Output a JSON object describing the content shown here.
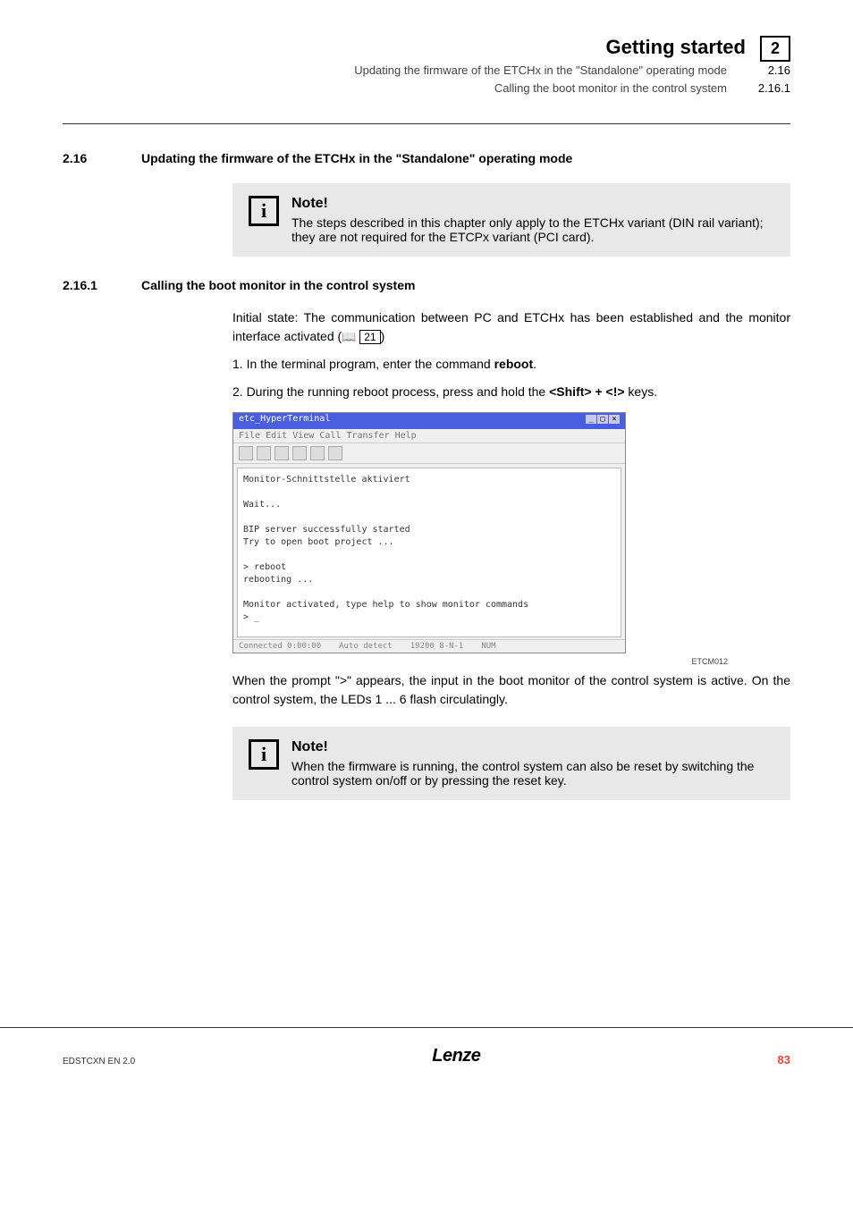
{
  "header": {
    "title": "Getting started",
    "sub1": "Updating the firmware of the ETCHx in the \"Standalone\" operating mode",
    "sub2": "Calling the boot monitor in the control system",
    "chapter": "2",
    "sec1": "2.16",
    "sec2": "2.16.1"
  },
  "s1": {
    "num": "2.16",
    "title": "Updating the firmware of the ETCHx in the \"Standalone\" operating mode"
  },
  "note_i": "i",
  "note1": {
    "heading": "Note!",
    "body": "The steps described in this chapter only apply to the ETCHx variant (DIN rail variant); they are not required for the ETCPx variant (PCI card)."
  },
  "s2": {
    "num": "2.16.1",
    "title": "Calling the boot monitor in the control system"
  },
  "p1a": "Initial state: The communication between PC and ETCHx has been established and the monitor interface activated (",
  "book": "📖",
  "p1b": "21",
  "p1c": ")",
  "li1a": "1. In the terminal program, enter the command ",
  "li1b": "reboot",
  "li1c": ".",
  "li2a": "2. During the running reboot process, press and hold the ",
  "li2b": "<Shift> + <!>",
  "li2c": " keys.",
  "shot": {
    "title": "etc_HyperTerminal",
    "menu": "File  Edit  View  Call  Transfer  Help",
    "term": "Monitor-Schnittstelle aktiviert\n\nWait...\n\nBIP server successfully started\nTry to open boot project ...\n\n> reboot\nrebooting ...\n\nMonitor activated, type help to show monitor commands\n> _",
    "status1": "Connected 0:00:00",
    "status2": "Auto detect",
    "status3": "19200 8-N-1",
    "status4": "NUM"
  },
  "figcap": "ETCM012",
  "p2": "When the prompt \">\" appears, the input in the boot monitor of the control system is active. On the control system, the LEDs 1 ... 6 flash circulatingly.",
  "note2": {
    "heading": "Note!",
    "body": "When the firmware is running, the control system can also be reset by switching the control system on/off or by pressing the reset key."
  },
  "footer": {
    "left": "EDSTCXN EN 2.0",
    "center": "Lenze",
    "right": "83"
  }
}
